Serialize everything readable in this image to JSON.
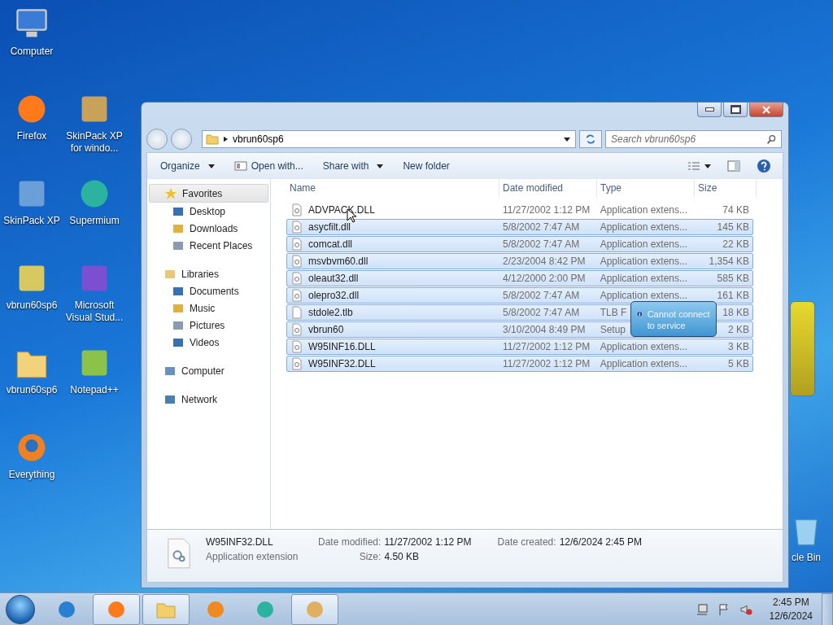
{
  "desktop": {
    "icons": [
      {
        "label": "Computer"
      },
      {
        "label": "Firefox"
      },
      {
        "label": "SkinPack XP for windo..."
      },
      {
        "label": "SkinPack XP"
      },
      {
        "label": "Supermium"
      },
      {
        "label": "vbrun60sp6"
      },
      {
        "label": "Microsoft Visual Stud..."
      },
      {
        "label": "vbrun60sp6"
      },
      {
        "label": "Notepad++"
      },
      {
        "label": "Everything"
      },
      {
        "label": "cle Bin"
      }
    ]
  },
  "window": {
    "address": "vbrun60sp6",
    "search": {
      "placeholder": "Search vbrun60sp6"
    },
    "toolbar": [
      {
        "label": "Organize",
        "dropdown": true
      },
      {
        "label": "Open with...",
        "dropdown": false
      },
      {
        "label": "Share with",
        "dropdown": true
      },
      {
        "label": "New folder",
        "dropdown": false
      }
    ],
    "sidebar": {
      "items": [
        {
          "label": "Favorites",
          "selected": true,
          "children": [
            {
              "label": "Desktop",
              "selected": false
            },
            {
              "label": "Downloads",
              "selected": false
            },
            {
              "label": "Recent Places",
              "selected": false
            }
          ]
        },
        {
          "label": "Libraries",
          "selected": false,
          "children": [
            {
              "label": "Documents",
              "selected": false
            },
            {
              "label": "Music",
              "selected": false
            },
            {
              "label": "Pictures",
              "selected": false
            },
            {
              "label": "Videos",
              "selected": false
            }
          ]
        },
        {
          "label": "Computer",
          "selected": false
        },
        {
          "label": "Network",
          "selected": false
        }
      ]
    },
    "table": {
      "columns": [
        "Name",
        "Date modified",
        "Type",
        "Size"
      ],
      "rows": [
        {
          "name": "ADVPACK.DLL",
          "date": "11/27/2002 1:12 PM",
          "type": "Application extens...",
          "size": "74 KB",
          "selected": false
        },
        {
          "name": "asycfilt.dll",
          "date": "5/8/2002 7:47 AM",
          "type": "Application extens...",
          "size": "145 KB",
          "selected": true
        },
        {
          "name": "comcat.dll",
          "date": "5/8/2002 7:47 AM",
          "type": "Application extens...",
          "size": "22 KB",
          "selected": true
        },
        {
          "name": "msvbvm60.dll",
          "date": "2/23/2004 8:42 PM",
          "type": "Application extens...",
          "size": "1,354 KB",
          "selected": true
        },
        {
          "name": "oleaut32.dll",
          "date": "4/12/2000 2:00 PM",
          "type": "Application extens...",
          "size": "585 KB",
          "selected": true
        },
        {
          "name": "olepro32.dll",
          "date": "5/8/2002 7:47 AM",
          "type": "Application extens...",
          "size": "161 KB",
          "selected": true
        },
        {
          "name": "stdole2.tlb",
          "date": "5/8/2002 7:47 AM",
          "type": "TLB F",
          "size": "18 KB",
          "selected": true
        },
        {
          "name": "vbrun60",
          "date": "3/10/2004 8:49 PM",
          "type": "Setup",
          "size": "2 KB",
          "selected": true
        },
        {
          "name": "W95INF16.DLL",
          "date": "11/27/2002 1:12 PM",
          "type": "Application extens...",
          "size": "3 KB",
          "selected": true
        },
        {
          "name": "W95INF32.DLL",
          "date": "11/27/2002 1:12 PM",
          "type": "Application extens...",
          "size": "5 KB",
          "selected": true
        }
      ]
    },
    "balloon": {
      "text": "Cannot connect to service"
    },
    "details": {
      "name": "W95INF32.DLL",
      "type": "Application extension",
      "modified_label": "Date modified:",
      "modified": "11/27/2002 1:12 PM",
      "size_label": "Size:",
      "size": "4.50 KB",
      "created_label": "Date created:",
      "created": "12/6/2024 2:45 PM"
    }
  },
  "taskbar": {
    "items": [
      {
        "active": false
      },
      {
        "active": true
      },
      {
        "active": true
      },
      {
        "active": false
      },
      {
        "active": false
      },
      {
        "active": true
      }
    ],
    "time": "2:45 PM",
    "date": "12/6/2024"
  }
}
